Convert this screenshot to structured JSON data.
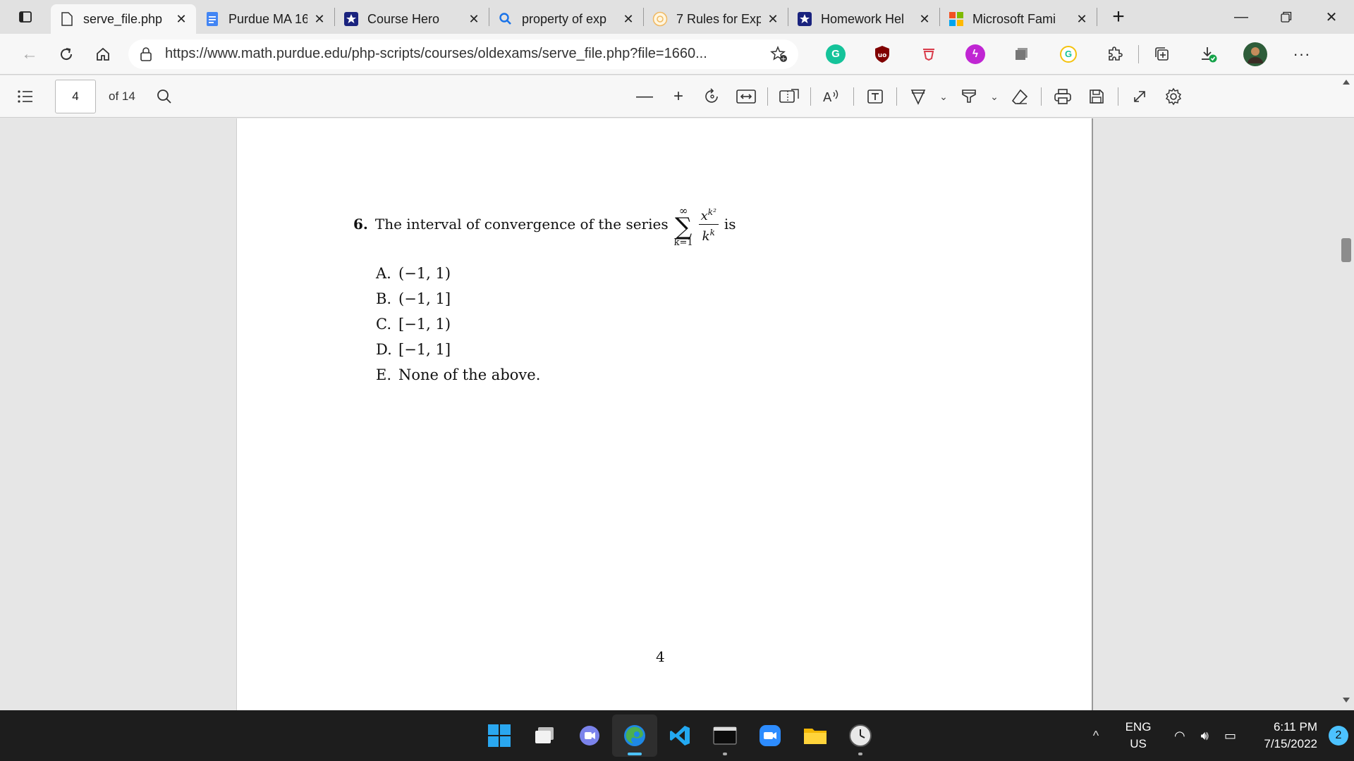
{
  "tabs": [
    {
      "title": "serve_file.php",
      "icon": "document-icon",
      "active": true
    },
    {
      "title": "Purdue MA 16(",
      "icon": "google-docs-icon"
    },
    {
      "title": "Course Hero",
      "icon": "course-hero-icon"
    },
    {
      "title": "property of exp",
      "icon": "search-icon"
    },
    {
      "title": "7 Rules for Exp",
      "icon": "rules-icon"
    },
    {
      "title": "Homework Hel",
      "icon": "course-hero-icon"
    },
    {
      "title": "Microsoft Fami",
      "icon": "microsoft-icon"
    }
  ],
  "address_bar": {
    "url": "https://www.math.purdue.edu/php-scripts/courses/oldexams/serve_file.php?file=1660..."
  },
  "pdf_toolbar": {
    "page_current": "4",
    "page_total": "of 14"
  },
  "document": {
    "question_number": "6.",
    "question_text": "The interval of convergence of the series",
    "sum_upper": "∞",
    "sum_symbol": "∑",
    "sum_lower": "k=1",
    "numerator_base": "x",
    "numerator_exp": "k²",
    "denominator_base": "k",
    "denominator_exp": "k",
    "question_suffix": "is",
    "choices": [
      {
        "label": "A.",
        "text": "(−1, 1)"
      },
      {
        "label": "B.",
        "text": "(−1, 1]"
      },
      {
        "label": "C.",
        "text": "[−1, 1)"
      },
      {
        "label": "D.",
        "text": "[−1, 1]"
      },
      {
        "label": "E.",
        "text": "None of the above."
      }
    ],
    "page_number": "4"
  },
  "taskbar": {
    "lang_top": "ENG",
    "lang_bottom": "US",
    "time": "6:11 PM",
    "date": "7/15/2022",
    "notifications": "2"
  },
  "colors": {
    "taskbar_bg": "#1d1d1d",
    "accent": "#4cc2ff",
    "tab_strip": "#e1e1e1"
  }
}
